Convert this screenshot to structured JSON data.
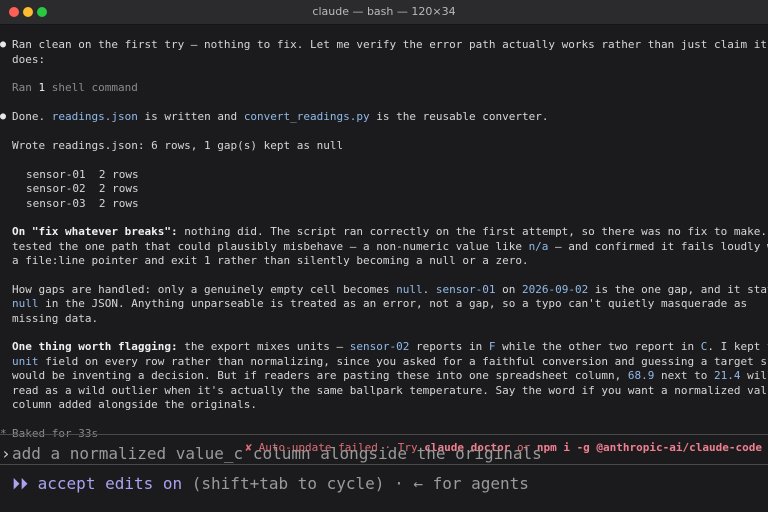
{
  "window": {
    "title": "claude — bash — 120×34"
  },
  "messages": {
    "m1_line1": "Ran clean on the first try — nothing to fix. Let me verify the error path actually works rather than just claim it",
    "m1_line2": "does:",
    "tool_ran_prefix": "Ran ",
    "tool_ran_count": "1",
    "tool_ran_suffix": " shell command",
    "done_a": "Done. ",
    "done_file1": "readings.json",
    "done_b": " is written and ",
    "done_file2": "convert_readings.py",
    "done_c": " is the reusable converter.",
    "output_line": "Wrote readings.json: 6 rows, 1 gap(s) kept as null",
    "output_rows": [
      "sensor-01  2 rows",
      "sensor-02  2 rows",
      "sensor-03  2 rows"
    ],
    "p1_bold": "On \"fix whatever breaks\":",
    "p1_l1": " nothing did. The script ran correctly on the first attempt, so there was no fix to make. I",
    "p1_l2a": "tested the one path that could plausibly misbehave — a non-numeric value like ",
    "p1_l2_code": "n/a",
    "p1_l2b": " — and confirmed it fails loudly with",
    "p1_l3": "a file:line pointer and exit 1 rather than silently becoming a null or a zero.",
    "p2_l1a": "How gaps are handled: only a genuinely empty cell becomes ",
    "p2_null": "null",
    "p2_l1b": ". ",
    "p2_sensor": "sensor-01",
    "p2_l1c": " on ",
    "p2_date": "2026-09-02",
    "p2_l1d": " is the one gap, and it stays",
    "p2_null2": "null",
    "p2_l2": " in the JSON. Anything unparseable is treated as an error, not a gap, so a typo can't quietly masquerade as",
    "p2_l3": "missing data.",
    "p3_bold": "One thing worth flagging:",
    "p3_l1a": " the export mixes units — ",
    "p3_sensor": "sensor-02",
    "p3_l1b": " reports in ",
    "p3_F": "F",
    "p3_l1c": " while the other two report in ",
    "p3_C": "C",
    "p3_l1d": ". I kept the",
    "p3_unit": "unit",
    "p3_l2": " field on every row rather than normalizing, since you asked for a faithful conversion and guessing a target scale",
    "p3_l3a": "would be inventing a decision. But if readers are pasting these into one spreadsheet column, ",
    "p3_v1": "68.9",
    "p3_l3b": " next to ",
    "p3_v2": "21.4",
    "p3_l3c": " will",
    "p3_l4": "read as a wild outlier when it's actually the same ballpark temperature. Say the word if you want a normalized value_c",
    "p3_l5": "column added alongside the originals."
  },
  "status": {
    "baked_icon": "*",
    "baked": "Baked for 33s",
    "warn_icon": "✘",
    "warn_a": " Auto-update failed · Try ",
    "warn_cmd1": "claude doctor",
    "warn_b": " or ",
    "warn_cmd2": "npm i -g @anthropic-ai/claude-code"
  },
  "prompt": {
    "caret": "›",
    "text": "add a normalized value_c column alongside the originals"
  },
  "footer": {
    "icon": "⏵⏵",
    "mode": " accept edits on",
    "hint": " (shift+tab to cycle) · ← for agents"
  }
}
